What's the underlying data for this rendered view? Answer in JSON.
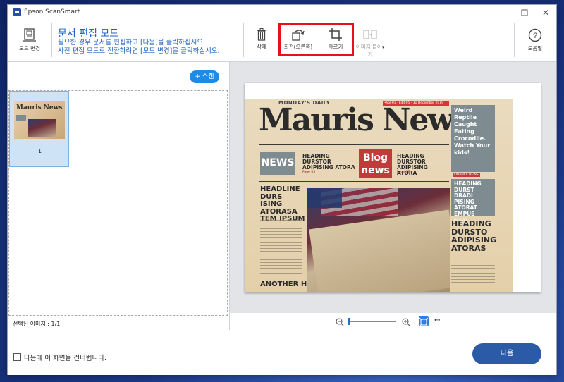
{
  "window": {
    "title": "Epson ScanSmart"
  },
  "toolbar": {
    "mode_change_label": "모드 변경",
    "mode_title": "문서 편집 모드",
    "mode_desc_line1": "필요한 경우 문서를 편집하고 [다음]을 클릭하십시오.",
    "mode_desc_line2": "사진 편집 모드로 전환하려면 [모드 변경]을 클릭하십시오.",
    "delete_label": "삭제",
    "rotate_label": "회전(오른쪽)",
    "crop_label": "자르기",
    "merge_label_1": "이미지 붙이",
    "merge_label_2": "기",
    "help_label": "도움말"
  },
  "left_panel": {
    "scan_button_label": "+ 스캔",
    "thumbnails": [
      {
        "number": "1"
      }
    ],
    "status_text": "선택된 이미지 : 1/1"
  },
  "newspaper": {
    "daily": "MONDAY'S DAILY",
    "red_strip": "•Vol·01  •Edit·05  •31 December 2019",
    "title": "Mauris News",
    "news_box": "NEWS",
    "headline_top_left": "HEADING DURSTOR ADIPISING ATORA",
    "blog_line1": "Blog",
    "blog_line2": "news",
    "headline_top_right": "HEADING DURSTOR ADIPISING ATORA",
    "page05": "Page 05",
    "page07": "Page 07",
    "left_headline": "HEADLINE DURS ISING ATORASA TEM IPSUM",
    "another": "ANOTHER HEA",
    "side_heading": "Weird Reptile Caught Eating Crocodile. Watch Your kids!",
    "finance_news": "FINANCE NEWS",
    "side_heading2": "HEADING DURST DRADI PISING ATORAT EMPUS",
    "page02": "Page 02",
    "big_headline": "HEADING DURSTO ADIPISING ATORAS"
  },
  "bottom": {
    "skip_checkbox_label": "다음에 이 화면을 건너뜁니다.",
    "next_button_label": "다음"
  },
  "colors": {
    "accent_blue": "#2b5aa6",
    "highlight_red": "#e8101a",
    "scan_blue": "#1f8be6"
  },
  "zoom": {
    "level_fraction": 0.0
  }
}
